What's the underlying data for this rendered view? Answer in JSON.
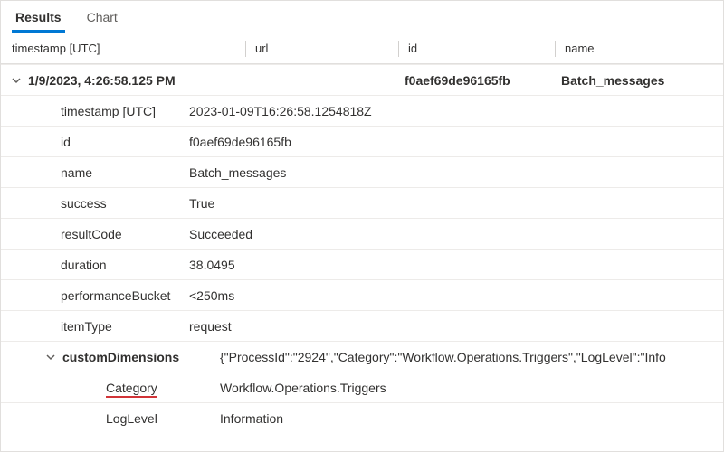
{
  "tabs": {
    "results": "Results",
    "chart": "Chart"
  },
  "columns": {
    "timestamp": "timestamp [UTC]",
    "url": "url",
    "id": "id",
    "name": "name"
  },
  "group": {
    "timestamp": "1/9/2023, 4:26:58.125 PM",
    "url": "",
    "id": "f0aef69de96165fb",
    "name": "Batch_messages"
  },
  "details": {
    "timestamp_label": "timestamp [UTC]",
    "timestamp_value": "2023-01-09T16:26:58.1254818Z",
    "id_label": "id",
    "id_value": "f0aef69de96165fb",
    "name_label": "name",
    "name_value": "Batch_messages",
    "success_label": "success",
    "success_value": "True",
    "resultCode_label": "resultCode",
    "resultCode_value": "Succeeded",
    "duration_label": "duration",
    "duration_value": "38.0495",
    "performanceBucket_label": "performanceBucket",
    "performanceBucket_value": "<250ms",
    "itemType_label": "itemType",
    "itemType_value": "request",
    "customDimensions_label": "customDimensions",
    "customDimensions_value": "{\"ProcessId\":\"2924\",\"Category\":\"Workflow.Operations.Triggers\",\"LogLevel\":\"Info",
    "cd_category_label": "Category",
    "cd_category_value": "Workflow.Operations.Triggers",
    "cd_loglevel_label": "LogLevel",
    "cd_loglevel_value": "Information"
  }
}
